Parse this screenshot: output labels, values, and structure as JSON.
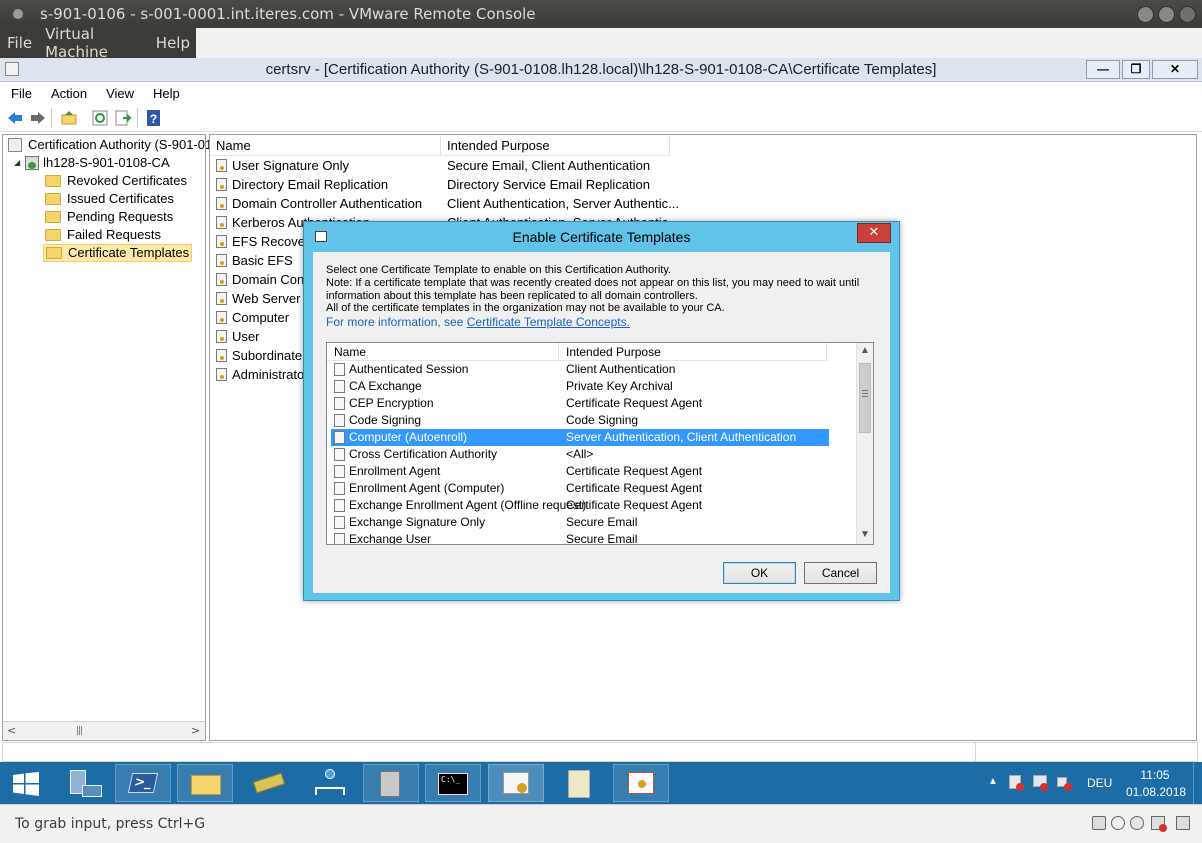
{
  "ubuntu": {
    "title": "s-901-0106 - s-001-0001.int.iteres.com - VMware Remote Console",
    "menu": [
      "File",
      "Virtual Machine",
      "Help"
    ]
  },
  "mmc": {
    "title": "certsrv - [Certification Authority (S-901-0108.lh128.local)\\lh128-S-901-0108-CA\\Certificate Templates]",
    "menu": [
      "File",
      "Action",
      "View",
      "Help"
    ],
    "tree": {
      "root": "Certification Authority (S-901-010",
      "ca": "lh128-S-901-0108-CA",
      "items": [
        "Revoked Certificates",
        "Issued Certificates",
        "Pending Requests",
        "Failed Requests",
        "Certificate Templates"
      ],
      "selected": "Certificate Templates"
    },
    "columns": [
      "Name",
      "Intended Purpose"
    ],
    "rows": [
      [
        "User Signature Only",
        "Secure Email, Client Authentication"
      ],
      [
        "Directory Email Replication",
        "Directory Service Email Replication"
      ],
      [
        "Domain Controller Authentication",
        "Client Authentication, Server Authentic..."
      ],
      [
        "Kerberos Authentication",
        "Client Authentication, Server Authentic..."
      ],
      [
        "EFS Recovery",
        ""
      ],
      [
        "Basic EFS",
        ""
      ],
      [
        "Domain Cont",
        ""
      ],
      [
        "Web Server",
        ""
      ],
      [
        "Computer",
        ""
      ],
      [
        "User",
        ""
      ],
      [
        "Subordinate C",
        ""
      ],
      [
        "Administrato",
        ""
      ]
    ]
  },
  "dialog": {
    "title": "Enable Certificate Templates",
    "line1": "Select one Certificate Template to enable on this Certification Authority.",
    "line2": "Note: If a certificate template that was recently created does not appear on this list, you may need to wait until",
    "line3": "information about this template has been replicated to all domain controllers.",
    "line4": "All of the certificate templates in the organization may not be available to your CA.",
    "more_info": "For more information, see",
    "link": "Certificate Template Concepts.",
    "columns": [
      "Name",
      "Intended Purpose"
    ],
    "rows": [
      [
        "Authenticated Session",
        "Client Authentication"
      ],
      [
        "CA Exchange",
        "Private Key Archival"
      ],
      [
        "CEP Encryption",
        "Certificate Request Agent"
      ],
      [
        "Code Signing",
        "Code Signing"
      ],
      [
        "Computer (Autoenroll)",
        "Server Authentication, Client Authentication"
      ],
      [
        "Cross Certification Authority",
        "<All>"
      ],
      [
        "Enrollment Agent",
        "Certificate Request Agent"
      ],
      [
        "Enrollment Agent (Computer)",
        "Certificate Request Agent"
      ],
      [
        "Exchange Enrollment Agent (Offline request)",
        "Certificate Request Agent"
      ],
      [
        "Exchange Signature Only",
        "Secure Email"
      ],
      [
        "Exchange User",
        "Secure Email"
      ]
    ],
    "selected": "Computer (Autoenroll)",
    "ok": "OK",
    "cancel": "Cancel"
  },
  "taskbar": {
    "lang": "DEU",
    "time": "11:05",
    "date": "01.08.2018"
  },
  "status": {
    "hint": "To grab input, press Ctrl+G"
  },
  "colors": {
    "taskbar": "#1d6ca6",
    "dialog_frame": "#61c3e7",
    "selection": "#3399ff"
  }
}
